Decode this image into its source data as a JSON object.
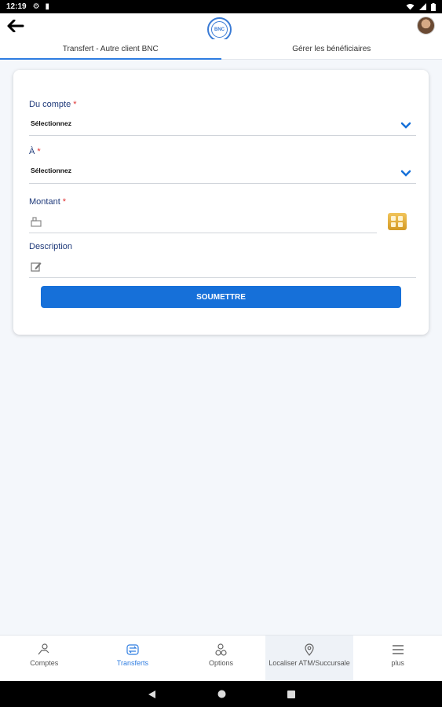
{
  "status_bar": {
    "time": "12:19",
    "icons": [
      "settings-icon",
      "sim-icon",
      "wifi-icon",
      "signal-icon",
      "battery-icon"
    ]
  },
  "header": {
    "logo_text": "BNC",
    "tabs": [
      {
        "label": "Transfert - Autre client BNC",
        "active": true
      },
      {
        "label": "Gérer les bénéficiaires",
        "active": false
      }
    ]
  },
  "form": {
    "from_account": {
      "label": "Du compte",
      "required_mark": "*",
      "value": "Sélectionnez"
    },
    "to_account": {
      "label": "À",
      "required_mark": "*",
      "value": "Sélectionnez"
    },
    "amount": {
      "label": "Montant",
      "required_mark": "*",
      "value": ""
    },
    "description": {
      "label": "Description",
      "value": ""
    },
    "submit_label": "SOUMETTRE"
  },
  "bottom_nav": {
    "items": [
      {
        "label": "Comptes",
        "icon": "accounts-icon"
      },
      {
        "label": "Transferts",
        "icon": "transfers-icon",
        "active": true
      },
      {
        "label": "Options",
        "icon": "options-icon"
      },
      {
        "label": "Localiser ATM/Succursale",
        "icon": "location-pin-icon"
      },
      {
        "label": "plus",
        "icon": "menu-icon"
      }
    ]
  },
  "colors": {
    "accent": "#1670d9",
    "label": "#1f3a7a",
    "required": "#e03131",
    "background": "#f4f7fb"
  }
}
